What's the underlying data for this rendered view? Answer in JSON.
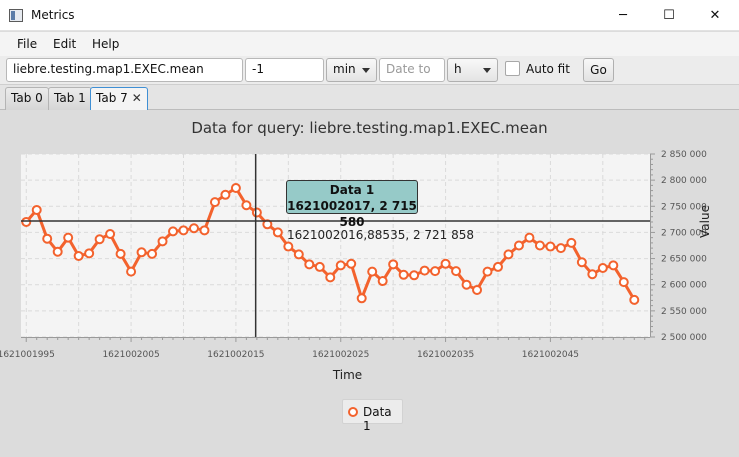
{
  "window": {
    "title": "Metrics",
    "minimize": "─",
    "maximize": "☐",
    "close": "✕"
  },
  "menu": [
    "File",
    "Edit",
    "Help"
  ],
  "toolbar": {
    "query_value": "liebre.testing.map1.EXEC.mean",
    "offset_value": "-1",
    "unit_selected": "min",
    "date_placeholder": "Date to",
    "hour_selected": "h",
    "autofit_label": "Auto fit",
    "go_label": "Go"
  },
  "tabs": [
    {
      "label": "Tab 0"
    },
    {
      "label": "Tab 1"
    },
    {
      "label": "Tab 7",
      "closable": true,
      "active": true
    }
  ],
  "colors": {
    "series": "#f3622d",
    "tooltip_bg": "#96cac8",
    "tab_active_border": "#3f8fd4"
  },
  "tooltip": {
    "line1": "Data 1",
    "line2": "1621002017, 2 715 580"
  },
  "hover_label": "1621002016,88535, 2 721 858",
  "chart_data": {
    "type": "line",
    "title": "Data for query: liebre.testing.map1.EXEC.mean",
    "xlabel": "Time",
    "ylabel": "Value",
    "xlim": [
      1621001994.5,
      1621002054.5
    ],
    "ylim": [
      2500000,
      2850000
    ],
    "x_ticks": [
      1621001995,
      1621002005,
      1621002015,
      1621002025,
      1621002035,
      1621002045
    ],
    "x_tick_labels": [
      "1621001995",
      "1621002005",
      "1621002015",
      "1621002025",
      "1621002035",
      "1621002045"
    ],
    "y_ticks": [
      2500000,
      2550000,
      2600000,
      2650000,
      2700000,
      2750000,
      2800000,
      2850000
    ],
    "y_tick_labels": [
      "2 500 000",
      "2 550 000",
      "2 600 000",
      "2 650 000",
      "2 700 000",
      "2 750 000",
      "2 800 000",
      "2 850 000"
    ],
    "grid": true,
    "legend_position": "bottom",
    "crosshair": {
      "x": 1621002016.88535,
      "y": 2721858
    },
    "series": [
      {
        "name": "Data 1",
        "color": "#f3622d",
        "x": [
          1621001995,
          1621001996,
          1621001997,
          1621001998,
          1621001999,
          1621002000,
          1621002001,
          1621002002,
          1621002003,
          1621002004,
          1621002005,
          1621002006,
          1621002007,
          1621002008,
          1621002009,
          1621002010,
          1621002011,
          1621002012,
          1621002013,
          1621002014,
          1621002015,
          1621002016,
          1621002017,
          1621002018,
          1621002019,
          1621002020,
          1621002021,
          1621002022,
          1621002023,
          1621002024,
          1621002025,
          1621002026,
          1621002027,
          1621002028,
          1621002029,
          1621002030,
          1621002031,
          1621002032,
          1621002033,
          1621002034,
          1621002035,
          1621002036,
          1621002037,
          1621002038,
          1621002039,
          1621002040,
          1621002041,
          1621002042,
          1621002043,
          1621002044,
          1621002045,
          1621002046,
          1621002047,
          1621002048,
          1621002049,
          1621002050,
          1621002051,
          1621002052,
          1621002053
        ],
        "values": [
          2720000,
          2743000,
          2688000,
          2663000,
          2690000,
          2655000,
          2660000,
          2687000,
          2697000,
          2659000,
          2625000,
          2662000,
          2659000,
          2683000,
          2702000,
          2704000,
          2708000,
          2704000,
          2758000,
          2772000,
          2785000,
          2752000,
          2738000,
          2715580,
          2700000,
          2673000,
          2658000,
          2639000,
          2634000,
          2614000,
          2637000,
          2640000,
          2574000,
          2625000,
          2607000,
          2639000,
          2619000,
          2618000,
          2627000,
          2626000,
          2640000,
          2626000,
          2600000,
          2590000,
          2625000,
          2634000,
          2658000,
          2675000,
          2690000,
          2675000,
          2673000,
          2670000,
          2680000,
          2643000,
          2620000,
          2632000,
          2637000,
          2605000,
          2571000
        ]
      }
    ]
  }
}
